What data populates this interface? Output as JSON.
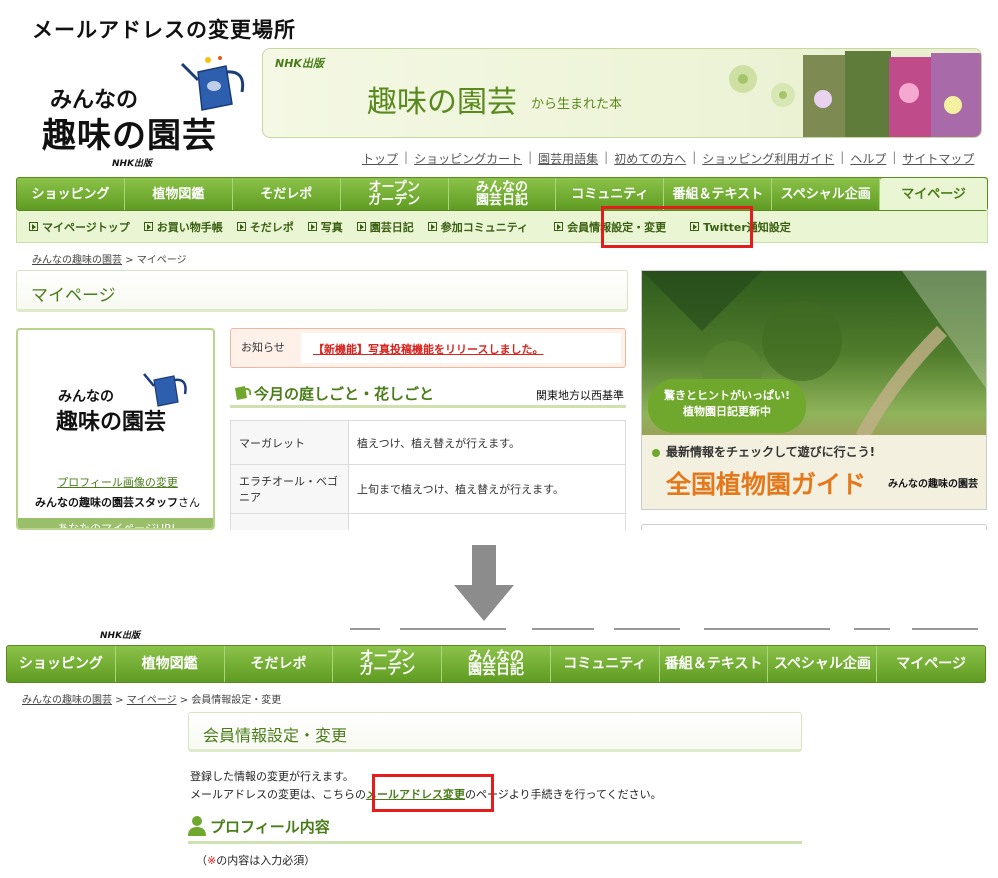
{
  "title": "メールアドレスの変更場所",
  "logo": {
    "line1": "みんなの",
    "line2": "趣味の園芸",
    "publisher": "NHK出版"
  },
  "banner": {
    "publisher": "NHK出版",
    "title": "趣味の園芸",
    "subtitle": "から生まれた本"
  },
  "util_links": [
    "トップ",
    "ショッピングカート",
    "園芸用語集",
    "初めての方へ",
    "ショッピング利用ガイド",
    "ヘルプ",
    "サイトマップ"
  ],
  "main_nav": [
    {
      "l1": "ショッピング",
      "l2": ""
    },
    {
      "l1": "植物図鑑",
      "l2": ""
    },
    {
      "l1": "そだレポ",
      "l2": ""
    },
    {
      "l1": "オープン",
      "l2": "ガーデン"
    },
    {
      "l1": "みんなの",
      "l2": "園芸日記"
    },
    {
      "l1": "コミュニティ",
      "l2": ""
    },
    {
      "l1": "番組＆テキスト",
      "l2": ""
    },
    {
      "l1": "スペシャル企画",
      "l2": ""
    },
    {
      "l1": "マイページ",
      "l2": ""
    }
  ],
  "sub_nav": [
    "マイページトップ",
    "お買い物手帳",
    "そだレポ",
    "写真",
    "園芸日記",
    "参加コミュニティ",
    "会員情報設定・変更",
    "Twitter通知設定"
  ],
  "breadcrumb_top": {
    "home": "みんなの趣味の園芸",
    "current": "マイページ"
  },
  "mypage_heading": "マイページ",
  "profile": {
    "line1": "みんなの",
    "line2": "趣味の園芸",
    "change_link": "プロフィール画像の変更",
    "name": "みんなの趣味の園芸スタッフ",
    "suffix": "さん",
    "url_label": "あなたのマイページURL"
  },
  "notice": {
    "label": "お知らせ",
    "message": "【新機能】写真投稿機能をリリースしました。"
  },
  "garden_work": {
    "title": "今月の庭しごと・花しごと",
    "region": "関東地方以西基準",
    "rows": [
      {
        "plant": "マーガレット",
        "task": "植えつけ、植え替えが行えます。"
      },
      {
        "plant": "エラチオール・ベゴニア",
        "task": "上旬まで植えつけ、植え替えが行えます。"
      },
      {
        "plant": "",
        "task": ""
      }
    ]
  },
  "ad": {
    "bubble1": "驚きとヒントがいっぱい!",
    "bubble2": "植物園日記更新中",
    "line1": "最新情報をチェックして遊びに行こう!",
    "line2": "全国植物園ガイド",
    "brand": "みんなの趣味の園芸"
  },
  "bottom": {
    "publisher": "NHK出版",
    "breadcrumb": {
      "home": "みんなの趣味の園芸",
      "mypage": "マイページ",
      "current": "会員情報設定・変更"
    },
    "heading": "会員情報設定・変更",
    "text1": "登録した情報の変更が行えます。",
    "text2_pre": "メールアドレスの変更は、こちらの",
    "text2_link": "メールアドレス変更",
    "text2_post": "のページより手続きを行ってください。",
    "profile_heading": "プロフィール内容",
    "required_note_pre": "（",
    "required_note_star": "※",
    "required_note_post": "の内容は入力必須）"
  },
  "colors": {
    "nav_green": "#6fa82c",
    "accent_green": "#4a7d1a",
    "highlight_red": "#e41c1c",
    "ad_orange": "#e5781a"
  }
}
